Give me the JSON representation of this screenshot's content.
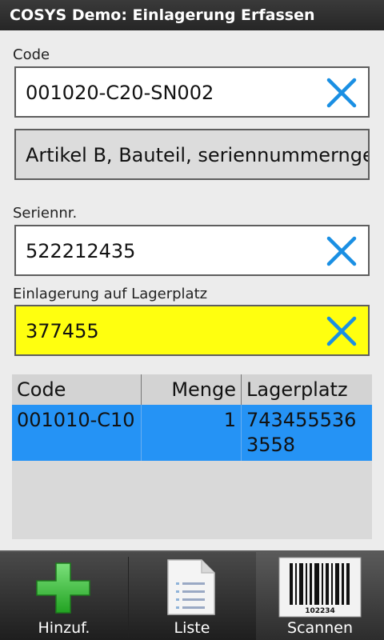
{
  "app": {
    "title": "COSYS Demo: Einlagerung Erfassen"
  },
  "form": {
    "code_label": "Code",
    "code_value": "001020-C20-SN002",
    "article_value": "Artikel B, Bauteil, seriennummerngeführt",
    "serial_label": "Seriennr.",
    "serial_value": "522212435",
    "location_label": "Einlagerung auf Lagerplatz",
    "location_value": "377455"
  },
  "table": {
    "columns": [
      "Code",
      "Menge",
      "Lagerplatz"
    ],
    "rows": [
      {
        "code": "001010-C10",
        "menge": "1",
        "lagerplatz": "7434555363558"
      }
    ]
  },
  "toolbar": {
    "add_label": "Hinzuf.",
    "list_label": "Liste",
    "scan_label": "Scannen",
    "barcode_number": "102234"
  },
  "colors": {
    "highlight_field": "#ffff0f",
    "selected_row": "#2593f5",
    "clear_icon": "#1a8fe3",
    "add_icon": "#3bc43b"
  }
}
